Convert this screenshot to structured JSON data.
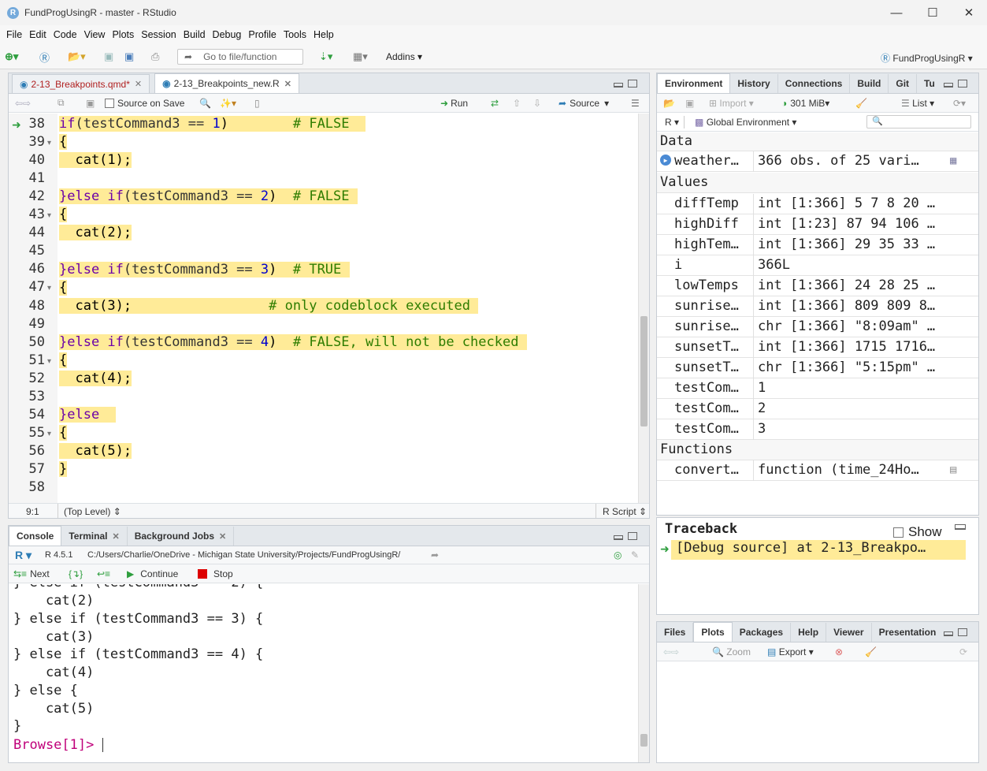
{
  "window": {
    "title": "FundProgUsingR - master - RStudio"
  },
  "menu": [
    "File",
    "Edit",
    "Code",
    "View",
    "Plots",
    "Session",
    "Build",
    "Debug",
    "Profile",
    "Tools",
    "Help"
  ],
  "toolbar": {
    "goto_placeholder": "Go to file/function",
    "addins": "Addins",
    "project": "FundProgUsingR"
  },
  "editor": {
    "tabs": [
      {
        "label": "2-13_Breakpoints.qmd*"
      },
      {
        "label": "2-13_Breakpoints_new.R"
      }
    ],
    "source_on_save": "Source on Save",
    "run": "Run",
    "source": "Source",
    "lines": [
      {
        "n": "38",
        "text": ""
      },
      {
        "n": "39",
        "text": "{"
      },
      {
        "n": "40",
        "text": "  cat(1);"
      },
      {
        "n": "41",
        "text": ""
      },
      {
        "n": "42",
        "text": ""
      },
      {
        "n": "43",
        "text": "{"
      },
      {
        "n": "44",
        "text": "  cat(2);"
      },
      {
        "n": "45",
        "text": ""
      },
      {
        "n": "46",
        "text": ""
      },
      {
        "n": "47",
        "text": "{"
      },
      {
        "n": "48",
        "text": ""
      },
      {
        "n": "49",
        "text": ""
      },
      {
        "n": "50",
        "text": ""
      },
      {
        "n": "51",
        "text": "{"
      },
      {
        "n": "52",
        "text": "  cat(4);"
      },
      {
        "n": "53",
        "text": ""
      },
      {
        "n": "54",
        "text": "}else"
      },
      {
        "n": "55",
        "text": "{"
      },
      {
        "n": "56",
        "text": "  cat(5);"
      },
      {
        "n": "57",
        "text": "}"
      },
      {
        "n": "58",
        "text": ""
      }
    ],
    "code38": {
      "a": "if",
      "b": "(testCommand3 == ",
      "c": "1",
      ")": ")",
      "cm": "# FALSE"
    },
    "code42": {
      "a": "}else if",
      "b": "(testCommand3 == ",
      "c": "2",
      "cm": "# FALSE"
    },
    "code46": {
      "a": "}else if",
      "b": "(testCommand3 == ",
      "c": "3",
      "cm": "# TRUE"
    },
    "code48": {
      "a": "  cat(3);",
      "cm": "# only codeblock executed"
    },
    "code50": {
      "a": "}else if",
      "b": "(testCommand3 == ",
      "c": "4",
      "cm": "# FALSE, will not be checked"
    },
    "status_pos": "9:1",
    "status_scope": "(Top Level)",
    "status_type": "R Script"
  },
  "environment": {
    "tabs": [
      "Environment",
      "History",
      "Connections",
      "Build",
      "Git",
      "Tu"
    ],
    "memory": "301 MiB",
    "import": "Import",
    "list": "List",
    "lang": "R",
    "scope": "Global Environment",
    "data_header": "Data",
    "values_header": "Values",
    "functions_header": "Functions",
    "data": [
      {
        "name": "weather…",
        "value": "366 obs. of 25 vari…"
      }
    ],
    "values": [
      {
        "name": "diffTemp",
        "value": "int [1:366] 5 7 8 20 …"
      },
      {
        "name": "highDiff",
        "value": "int [1:23] 87 94 106 …"
      },
      {
        "name": "highTem…",
        "value": "int [1:366] 29 35 33 …"
      },
      {
        "name": "i",
        "value": "366L"
      },
      {
        "name": "lowTemps",
        "value": "int [1:366] 24 28 25 …"
      },
      {
        "name": "sunrise…",
        "value": "int [1:366] 809 809 8…"
      },
      {
        "name": "sunrise…",
        "value": "chr [1:366] \"8:09am\" …"
      },
      {
        "name": "sunsetT…",
        "value": "int [1:366] 1715 1716…"
      },
      {
        "name": "sunsetT…",
        "value": "chr [1:366] \"5:15pm\" …"
      },
      {
        "name": "testCom…",
        "value": "1"
      },
      {
        "name": "testCom…",
        "value": "2"
      },
      {
        "name": "testCom…",
        "value": "3"
      }
    ],
    "functions": [
      {
        "name": "convert…",
        "value": "function (time_24Ho…"
      }
    ]
  },
  "traceback": {
    "title": "Traceback",
    "show": "Show",
    "entry": "[Debug source] at 2-13_Breakpo…"
  },
  "files": {
    "tabs": [
      "Files",
      "Plots",
      "Packages",
      "Help",
      "Viewer",
      "Presentation"
    ],
    "zoom": "Zoom",
    "export": "Export"
  },
  "console": {
    "tabs": [
      "Console",
      "Terminal",
      "Background Jobs"
    ],
    "version": "R 4.5.1",
    "path": "C:/Users/Charlie/OneDrive - Michigan State University/Projects/FundProgUsingR/",
    "next": "Next",
    "continue": "Continue",
    "stop": "Stop",
    "lines": [
      "} else if (testCommand3 == 2) {",
      "    cat(2)",
      "} else if (testCommand3 == 3) {",
      "    cat(3)",
      "} else if (testCommand3 == 4) {",
      "    cat(4)",
      "} else {",
      "    cat(5)",
      "}"
    ],
    "prompt": "Browse[1]>"
  },
  "colors": {
    "highlight": "#ffeb98",
    "keyword": "#6b00a8",
    "comment": "#2e7d00",
    "number": "#0000cd",
    "prompt": "#c0007a"
  }
}
